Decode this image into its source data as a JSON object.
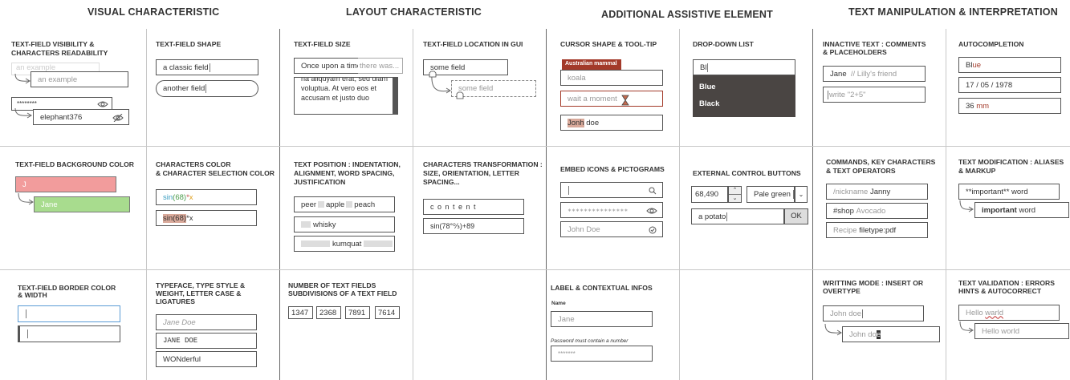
{
  "headers": {
    "visual": "VISUAL CHARACTERISTIC",
    "layout": "LAYOUT CHARACTERISTIC",
    "assistive": "ADDITIONAL ASSISTIVE ELEMENT",
    "text": "TEXT MANIPULATION & INTERPRETATION"
  },
  "c1": {
    "title1": "TEXT-FIELD VISIBILITY &",
    "title2": "CHARACTERS READABILITY",
    "ghost": "an example",
    "example": "an example",
    "pw_masked": "********",
    "pw_shown": "elephant376"
  },
  "c2": {
    "title": "TEXT-FIELD SHAPE",
    "classic": "a classic field",
    "another": "another field"
  },
  "c3": {
    "title": "TEXT-FIELD SIZE",
    "short1": "Once upon a time",
    "short2": "there was...",
    "multi1": "na aliquyam erat, sed diam",
    "multi2": "voluptua. At vero eos et",
    "multi3": "accusam et justo duo"
  },
  "c4": {
    "title": "TEXT-FIELD LOCATION IN GUI",
    "a": "some field",
    "b": "some field"
  },
  "c5": {
    "title": "CURSOR SHAPE & TOOL-TIP",
    "tooltip": "Australian mammal",
    "koala": "koala",
    "wait": "wait a moment",
    "jonh": "Jonh",
    "doe": "doe"
  },
  "c6": {
    "title": "DROP-DOWN LIST",
    "input": "Bl",
    "opt1": "Blue",
    "opt2": "Black"
  },
  "c7": {
    "title1": "INNACTIVE TEXT : COMMENTS",
    "title2": "& PLACEHOLDERS",
    "jane": "Jane",
    "comment": "// Lilly's friend",
    "placeholder": "write \"2+5\""
  },
  "c8": {
    "title": "AUTOCOMPLETION",
    "bl": "Bl",
    "ue": "ue",
    "date": "17  /  05  /  1978",
    "mm_num": "36",
    "mm_unit": "mm"
  },
  "r2": {
    "bg_title": "TEXT-FIELD BACKGROUND COLOR",
    "bg_j": "J",
    "bg_jane": "Jane",
    "cc_title1": "CHARACTERS COLOR",
    "cc_title2": "& CHARACTER SELECTION COLOR",
    "sin": "sin",
    "arg": "(68)",
    "star": "*",
    "x": "x",
    "sel": "sin(68)",
    "rest": "*x",
    "tp_title1": "TEXT POSITION : INDENTATION,",
    "tp_title2": "ALIGNMENT, WORD SPACING,",
    "tp_title3": "JUSTIFICATION",
    "peer": "peer",
    "apple": "apple",
    "peach": "peach",
    "whisky": "whisky",
    "kumquat": "kumquat",
    "ct_title1": "CHARACTERS TRANSFORMATION :",
    "ct_title2": "SIZE, ORIENTATION, LETTER",
    "ct_title3": "SPACING...",
    "content": "c o n t e n t",
    "sin2": "sin(78°↉)+89",
    "ei_title": "EMBED ICONS & PICTOGRAMS",
    "ei_pw": "∗∗∗∗∗∗∗∗∗∗∗∗∗∗∗",
    "ei_name": "John Doe",
    "ex_title": "EXTERNAL CONTROL BUTTONS",
    "ex_num": "68,490",
    "ex_color": "Pale green",
    "ex_potato": "a potato",
    "ex_ok": "OK",
    "ck_title1": "COMMANDS, KEY CHARACTERS",
    "ck_title2": "& TEXT OPERATORS",
    "nick": "/nickname",
    "janny": "Janny",
    "shop": "#shop",
    "avocado": "Avocado",
    "recipe": "Recipe",
    "filetype": "filetype:pdf",
    "tm_title1": "TEXT MODIFICATION : ALIASES",
    "tm_title2": "& MARKUP",
    "raw": "**important** word",
    "important": "important",
    "word": "word"
  },
  "r3": {
    "bc_title1": "TEXT-FIELD BORDER COLOR",
    "bc_title2": "& WIDTH",
    "tf_title1": "TYPEFACE, TYPE STYLE &",
    "tf_title2": "WEIGHT, LETTER CASE &",
    "tf_title3": "LIGATURES",
    "italic": "Jane Doe",
    "mono": "JANE DOE",
    "wonder": "WONderful",
    "nf_title1": "NUMBER OF TEXT FIELDS",
    "nf_title2": "SUBDIVISIONS OF A TEXT FIELD",
    "nums": [
      "1347",
      "2368",
      "7891",
      "7614"
    ],
    "lc_title": "LABEL & CONTEXTUAL INFOS",
    "lc_name": "Name",
    "lc_jane": "Jane",
    "lc_hint": "Password must contain a number",
    "lc_pw": "*******",
    "wm_title1": "WRITTING MODE : INSERT OR",
    "wm_title2": "OVERTYPE",
    "wm_a": "John doe",
    "wm_b1": "John do",
    "wm_b2": "e",
    "tv_title1": "TEXT VALIDATION : ERRORS",
    "tv_title2": "HINTS & AUTOCORRECT",
    "tv_hello": "Hello",
    "tv_warld": "warld",
    "tv_world": "Hello world"
  }
}
